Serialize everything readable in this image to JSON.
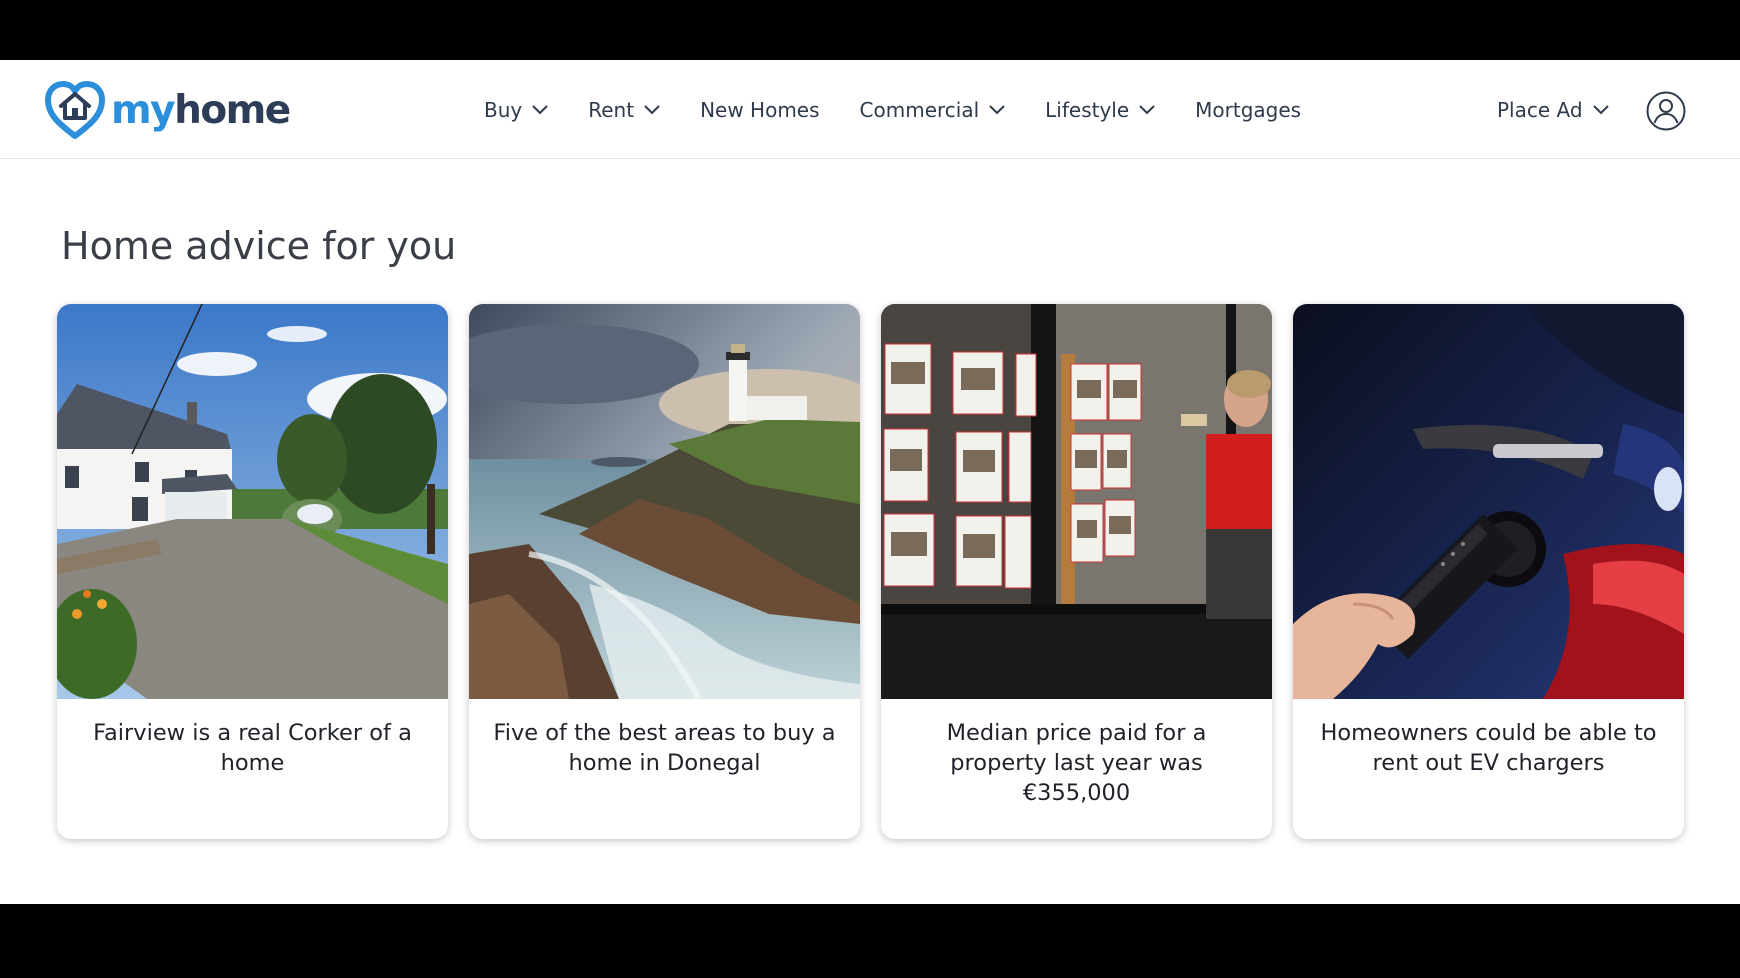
{
  "brand": {
    "my": "my",
    "home": "home",
    "accent": "#2b8fdc",
    "dark": "#2d3d58"
  },
  "nav": {
    "items": [
      {
        "label": "Buy",
        "has_dropdown": true
      },
      {
        "label": "Rent",
        "has_dropdown": true
      },
      {
        "label": "New Homes",
        "has_dropdown": false
      },
      {
        "label": "Commercial",
        "has_dropdown": true
      },
      {
        "label": "Lifestyle",
        "has_dropdown": true
      },
      {
        "label": "Mortgages",
        "has_dropdown": false
      }
    ],
    "place_ad": "Place Ad",
    "account_icon": "user-circle-icon"
  },
  "section": {
    "title": "Home advice for you"
  },
  "cards": [
    {
      "title": "Fairview is a real Corker of a home",
      "image": "white-farmhouse-with-gravel-drive"
    },
    {
      "title": "Five of the best areas to buy a home in Donegal",
      "image": "lighthouse-on-rocky-coast"
    },
    {
      "title": "Median price paid for a property last year was €355,000",
      "image": "estate-agent-window"
    },
    {
      "title": "Homeowners could be able to rent out EV chargers",
      "image": "ev-charger-plug"
    }
  ]
}
